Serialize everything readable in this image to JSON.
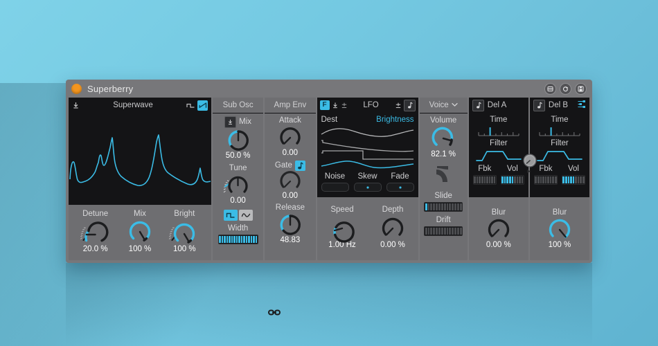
{
  "window": {
    "title": "Superberry",
    "led_color": "#f3951f",
    "titlebar_buttons": [
      {
        "name": "save-preset-icon",
        "label": "save-preset"
      },
      {
        "name": "refresh-icon",
        "label": "refresh"
      },
      {
        "name": "disk-icon",
        "label": "disk"
      }
    ]
  },
  "theme": {
    "accent": "#3bbce6",
    "panel_bg": "#6e6e71",
    "dark_bg": "#141416",
    "text": "#d9d9db"
  },
  "osc": {
    "header": {
      "title": "Superwave",
      "mod_icon": "modulation-icon",
      "wave_square_icon": "square-wave-icon",
      "wave_saw_icon": "saw-wave-icon",
      "wave_saw_selected": true
    },
    "knobs": [
      {
        "label": "Detune",
        "value": "20.0 %",
        "pct": 20,
        "has_mod_ring": true
      },
      {
        "label": "Mix",
        "value": "100 %",
        "pct": 100,
        "has_mod_ring": false
      },
      {
        "label": "Bright",
        "value": "100 %",
        "pct": 100,
        "has_mod_ring": true
      }
    ],
    "link_icon": "chain-link-icon"
  },
  "sub_osc": {
    "header": "Sub Osc",
    "mix": {
      "label": "Mix",
      "value": "50.0 %",
      "pct": 50,
      "mod_icon": "modulation-icon"
    },
    "tune": {
      "label": "Tune",
      "value": "0.00",
      "pct": 50,
      "has_mod_ring": true
    },
    "wave_buttons": [
      {
        "name": "square-wave-icon",
        "selected": true
      },
      {
        "name": "sine-wave-icon",
        "selected": false
      }
    ],
    "width": {
      "label": "Width",
      "segments_on": 16,
      "segments_total": 16
    }
  },
  "amp_env": {
    "header": "Amp Env",
    "attack": {
      "label": "Attack",
      "value": "0.00",
      "pct": 0
    },
    "gate": {
      "label": "Gate",
      "icon": "note-icon",
      "value": "0.00",
      "pct": 0
    },
    "release": {
      "label": "Release",
      "value": "48.83",
      "pct": 49
    }
  },
  "lfo": {
    "header": {
      "f_button": "F",
      "icons": [
        "modulation-icon",
        "bipolar-icon"
      ],
      "title": "LFO",
      "right_icons": [
        "bipolar-icon",
        "note-icon"
      ]
    },
    "dest_label": "Dest",
    "dest_value": "Brightness",
    "shape_sliders": [
      {
        "label": "Noise",
        "value": 0
      },
      {
        "label": "Skew",
        "value": 50
      },
      {
        "label": "Fade",
        "value": 50
      }
    ],
    "speed": {
      "label": "Speed",
      "value": "1.00 Hz",
      "pct": 22
    },
    "depth": {
      "label": "Depth",
      "value": "0.00 %",
      "pct": 0
    }
  },
  "voice": {
    "header": "Voice",
    "header_icon": "chevron-down-icon",
    "volume": {
      "label": "Volume",
      "value": "82.1 %",
      "pct": 82
    },
    "glide_icon": "glide-curve-icon",
    "slide": {
      "label": "Slide",
      "segments_on": 1,
      "segments_total": 14
    },
    "drift": {
      "label": "Drift",
      "segments_on": 0,
      "segments_total": 14
    }
  },
  "delay_a": {
    "header": "Del A",
    "header_icon": "note-icon",
    "time": {
      "label": "Time",
      "pct": 28
    },
    "filter": {
      "label": "Filter",
      "icon": "bandpass-filter-icon"
    },
    "fbk": {
      "label": "Fbk",
      "segments_on": 0,
      "segments_total": 9
    },
    "vol": {
      "label": "Vol",
      "segments_on": 5,
      "segments_total": 9
    },
    "blur": {
      "label": "Blur",
      "value": "0.00 %",
      "pct": 0
    }
  },
  "delay_b": {
    "header": "Del B",
    "header_icon": "note-icon",
    "link_icon": "routing-link-icon",
    "time": {
      "label": "Time",
      "pct": 28
    },
    "filter": {
      "label": "Filter",
      "icon": "bandpass-filter-icon"
    },
    "fbk": {
      "label": "Fbk",
      "segments_on": 0,
      "segments_total": 9
    },
    "vol": {
      "label": "Vol",
      "segments_on": 5,
      "segments_total": 9
    },
    "blur": {
      "label": "Blur",
      "value": "100 %",
      "pct": 100
    }
  },
  "delay_center_knob": {
    "name": "delay-balance-knob",
    "pct": 45
  }
}
